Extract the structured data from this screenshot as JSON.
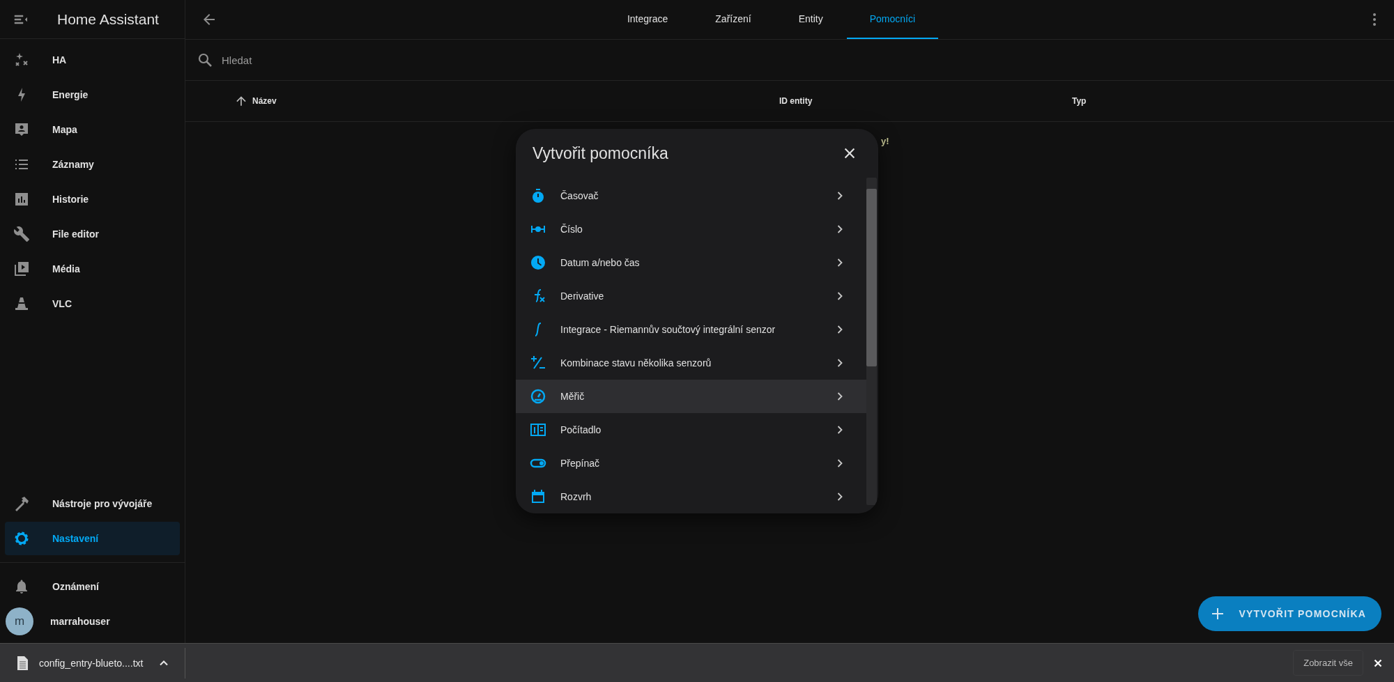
{
  "sidebar": {
    "title": "Home Assistant",
    "items": [
      {
        "label": "HA",
        "selected": false
      },
      {
        "label": "Energie",
        "selected": false
      },
      {
        "label": "Mapa",
        "selected": false
      },
      {
        "label": "Záznamy",
        "selected": false
      },
      {
        "label": "Historie",
        "selected": false
      },
      {
        "label": "File editor",
        "selected": false
      },
      {
        "label": "Média",
        "selected": false
      },
      {
        "label": "VLC",
        "selected": false
      }
    ],
    "bottom_items": [
      {
        "label": "Nástroje pro vývojáře",
        "selected": false
      },
      {
        "label": "Nastavení",
        "selected": true
      }
    ],
    "notifications": {
      "label": "Oznámení"
    },
    "user": {
      "initial": "m",
      "name": "marrahouser"
    }
  },
  "tabs": [
    {
      "label": "Integrace",
      "selected": false
    },
    {
      "label": "Zařízení",
      "selected": false
    },
    {
      "label": "Entity",
      "selected": false
    },
    {
      "label": "Pomocníci",
      "selected": true
    }
  ],
  "search": {
    "placeholder": "Hledat"
  },
  "table": {
    "columns": [
      "Název",
      "ID entity",
      "Typ"
    ],
    "empty_message": "y!"
  },
  "dialog": {
    "title": "Vytvořit pomocníka",
    "items": [
      {
        "label": "Časovač",
        "highlighted": false
      },
      {
        "label": "Číslo",
        "highlighted": false
      },
      {
        "label": "Datum a/nebo čas",
        "highlighted": false
      },
      {
        "label": "Derivative",
        "highlighted": false
      },
      {
        "label": "Integrace - Riemannův součtový integrální senzor",
        "highlighted": false
      },
      {
        "label": "Kombinace stavu několika senzorů",
        "highlighted": false
      },
      {
        "label": "Měřič",
        "highlighted": true
      },
      {
        "label": "Počítadlo",
        "highlighted": false
      },
      {
        "label": "Přepínač",
        "highlighted": false
      },
      {
        "label": "Rozvrh",
        "highlighted": false
      }
    ]
  },
  "fab": {
    "label": "VYTVOŘIT POMOCNÍKA"
  },
  "download_bar": {
    "file": "config_entry-blueto....txt",
    "show_all": "Zobrazit vše"
  }
}
